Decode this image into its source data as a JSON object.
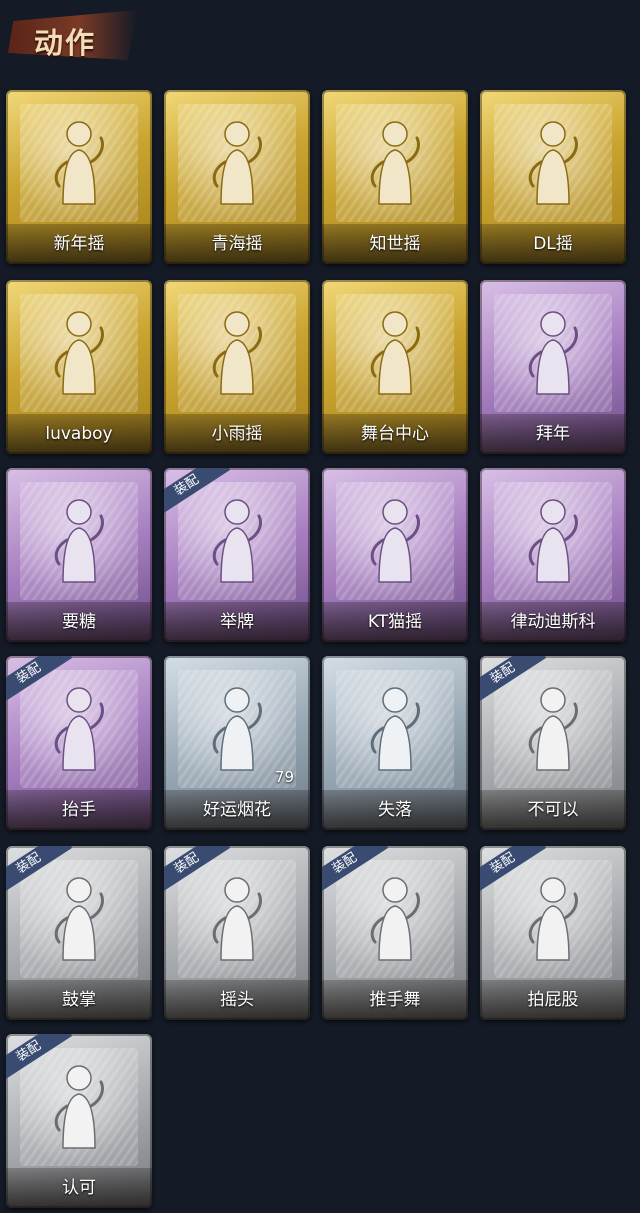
{
  "header": {
    "title": "动作"
  },
  "equipped_badge": "装配",
  "cards": [
    {
      "label": "新年摇",
      "rarity": "gold"
    },
    {
      "label": "青海摇",
      "rarity": "gold"
    },
    {
      "label": "知世摇",
      "rarity": "gold"
    },
    {
      "label": "DL摇",
      "rarity": "gold"
    },
    {
      "label": "luvaboy",
      "rarity": "gold"
    },
    {
      "label": "小雨摇",
      "rarity": "gold"
    },
    {
      "label": "舞台中心",
      "rarity": "gold"
    },
    {
      "label": "拜年",
      "rarity": "purple"
    },
    {
      "label": "要糖",
      "rarity": "purple"
    },
    {
      "label": "举牌",
      "rarity": "purple",
      "equipped": true
    },
    {
      "label": "KT猫摇",
      "rarity": "purple"
    },
    {
      "label": "律动迪斯科",
      "rarity": "purple"
    },
    {
      "label": "抬手",
      "rarity": "purple",
      "equipped": true
    },
    {
      "label": "好运烟花",
      "rarity": "silver",
      "count": "79"
    },
    {
      "label": "失落",
      "rarity": "silver"
    },
    {
      "label": "不可以",
      "rarity": "grey",
      "equipped": true
    },
    {
      "label": "鼓掌",
      "rarity": "grey",
      "equipped": true
    },
    {
      "label": "摇头",
      "rarity": "grey",
      "equipped": true
    },
    {
      "label": "推手舞",
      "rarity": "grey",
      "equipped": true
    },
    {
      "label": "拍屁股",
      "rarity": "grey",
      "equipped": true
    },
    {
      "label": "认可",
      "rarity": "grey",
      "equipped": true
    }
  ],
  "colors": {
    "background": "#141a26",
    "gold": "#c9a430",
    "purple": "#a77fc0",
    "silver": "#9aa9b6",
    "grey": "#a9acb0",
    "badge": "#3a4b72"
  }
}
